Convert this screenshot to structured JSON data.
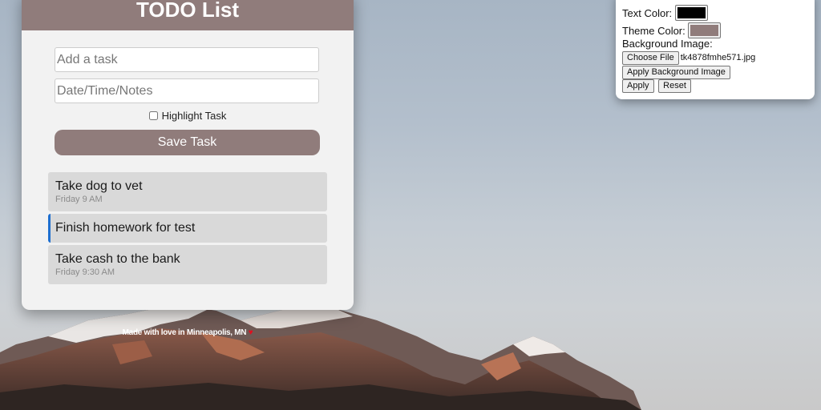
{
  "todo": {
    "title": "TODO List",
    "task_placeholder": "Add a task",
    "notes_placeholder": "Date/Time/Notes",
    "highlight_label": "Highlight Task",
    "save_label": "Save Task",
    "tasks": [
      {
        "title": "Take dog to vet",
        "note": "Friday 9 AM",
        "highlighted": false
      },
      {
        "title": "Finish homework for test",
        "note": "",
        "highlighted": true
      },
      {
        "title": "Take cash to the bank",
        "note": "Friday 9:30 AM",
        "highlighted": false
      }
    ],
    "theme_color": "#907c7b",
    "highlight_color": "#1e6fd0"
  },
  "footer": {
    "text": "Made with love in Minneapolis, MN",
    "heart": "♥"
  },
  "settings": {
    "text_color_label": "Text Color:",
    "text_color_value": "#000000",
    "theme_color_label": "Theme Color:",
    "theme_color_value": "#907c7b",
    "background_image_label": "Background Image:",
    "choose_file_label": "Choose File",
    "file_name": "tk4878fmhe571.jpg",
    "apply_bg_label": "Apply Background Image",
    "apply_label": "Apply",
    "reset_label": "Reset"
  }
}
